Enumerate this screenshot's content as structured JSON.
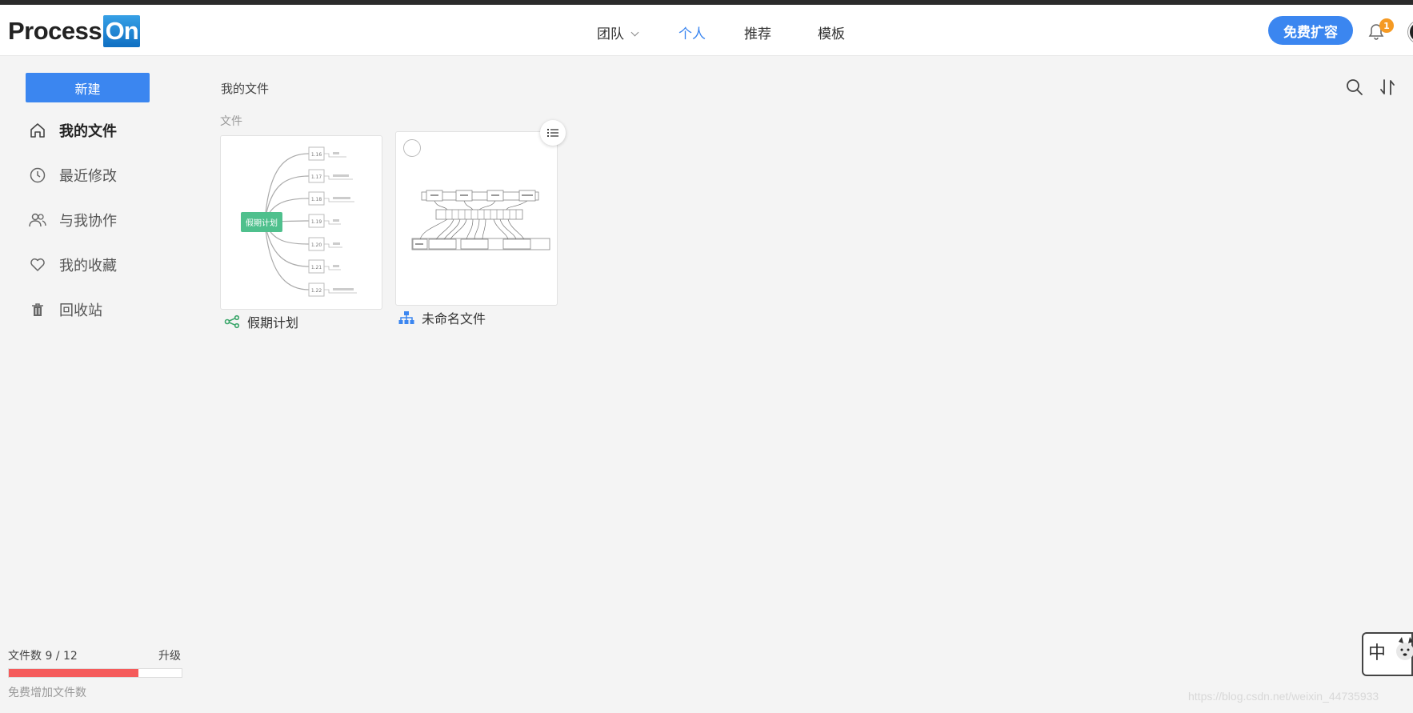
{
  "app": {
    "logo_text": "Process",
    "logo_badge": "On"
  },
  "nav": {
    "items": [
      {
        "label": "团队",
        "has_dropdown": true
      },
      {
        "label": "个人",
        "active": true
      },
      {
        "label": "推荐"
      },
      {
        "label": "模板"
      }
    ]
  },
  "header": {
    "upgrade_label": "免费扩容",
    "notification_count": "1"
  },
  "sidebar": {
    "new_button": "新建",
    "items": [
      {
        "label": "我的文件",
        "icon": "home-icon",
        "active": true
      },
      {
        "label": "最近修改",
        "icon": "clock-icon"
      },
      {
        "label": "与我协作",
        "icon": "users-icon"
      },
      {
        "label": "我的收藏",
        "icon": "heart-icon"
      },
      {
        "label": "回收站",
        "icon": "trash-icon"
      }
    ],
    "quota": {
      "label": "文件数 9 / 12",
      "upgrade": "升级",
      "used": 9,
      "total": 12,
      "hint": "免费增加文件数"
    }
  },
  "main": {
    "breadcrumb": "我的文件",
    "section": "文件",
    "files": [
      {
        "name": "假期计划",
        "type": "mindmap",
        "icon": "mindmap-icon",
        "preview": {
          "root": "假期计划",
          "nodes": [
            "1.16",
            "1.17",
            "1.18",
            "1.19",
            "1.20",
            "1.21",
            "1.22"
          ]
        }
      },
      {
        "name": "未命名文件",
        "type": "flowchart",
        "icon": "org-chart-icon"
      }
    ]
  },
  "ime": {
    "char": "中"
  },
  "watermark": "https://blog.csdn.net/weixin_44735933",
  "colors": {
    "accent": "#3b86f0",
    "quota_fill": "#f55b5b",
    "mindmap_root": "#4fc08d",
    "badge": "#f59a23"
  }
}
